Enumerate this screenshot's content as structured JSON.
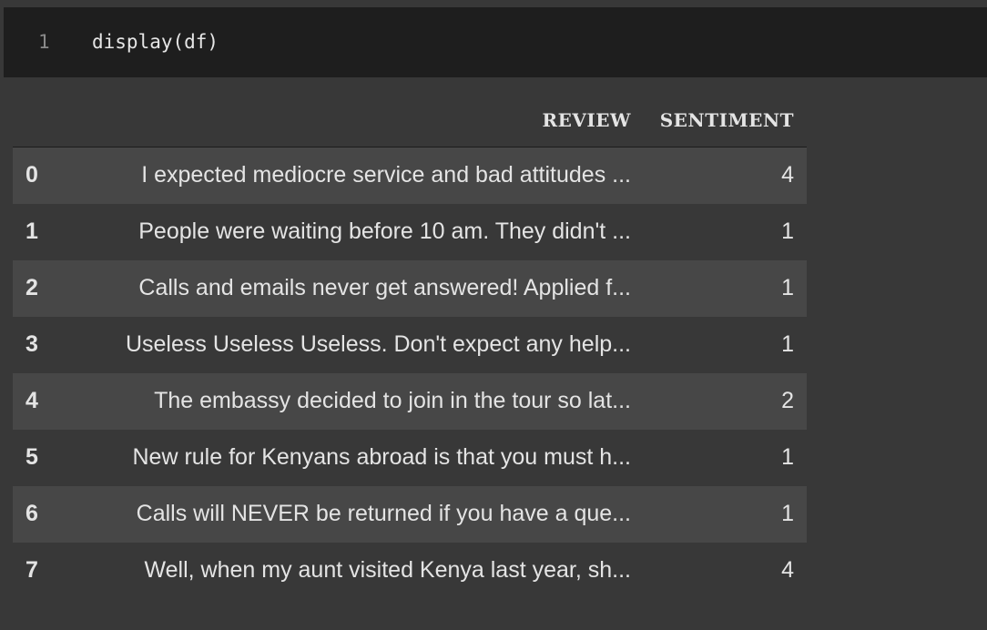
{
  "code_cell": {
    "line_number": "1",
    "code": "display(df)"
  },
  "output": {
    "columns": [
      "REVIEW",
      "SENTIMENT"
    ],
    "rows": [
      {
        "index": "0",
        "review": "I expected mediocre service and bad attitudes ...",
        "sentiment": "4"
      },
      {
        "index": "1",
        "review": "People were waiting before 10 am. They didn't ...",
        "sentiment": "1"
      },
      {
        "index": "2",
        "review": "Calls and emails never get answered! Applied f...",
        "sentiment": "1"
      },
      {
        "index": "3",
        "review": "Useless Useless Useless. Don't expect any help...",
        "sentiment": "1"
      },
      {
        "index": "4",
        "review": "The embassy decided to join in the tour so lat...",
        "sentiment": "2"
      },
      {
        "index": "5",
        "review": "New rule for Kenyans abroad is that you must h...",
        "sentiment": "1"
      },
      {
        "index": "6",
        "review": "Calls will NEVER be returned if you have a que...",
        "sentiment": "1"
      },
      {
        "index": "7",
        "review": "Well, when my aunt visited Kenya last year, sh...",
        "sentiment": "4"
      }
    ]
  },
  "colors": {
    "code_background": "#1e1e1e",
    "output_background": "#383838",
    "row_stripe": "#474747",
    "text": "#e4e4e4",
    "line_number": "#8a8a8a"
  }
}
